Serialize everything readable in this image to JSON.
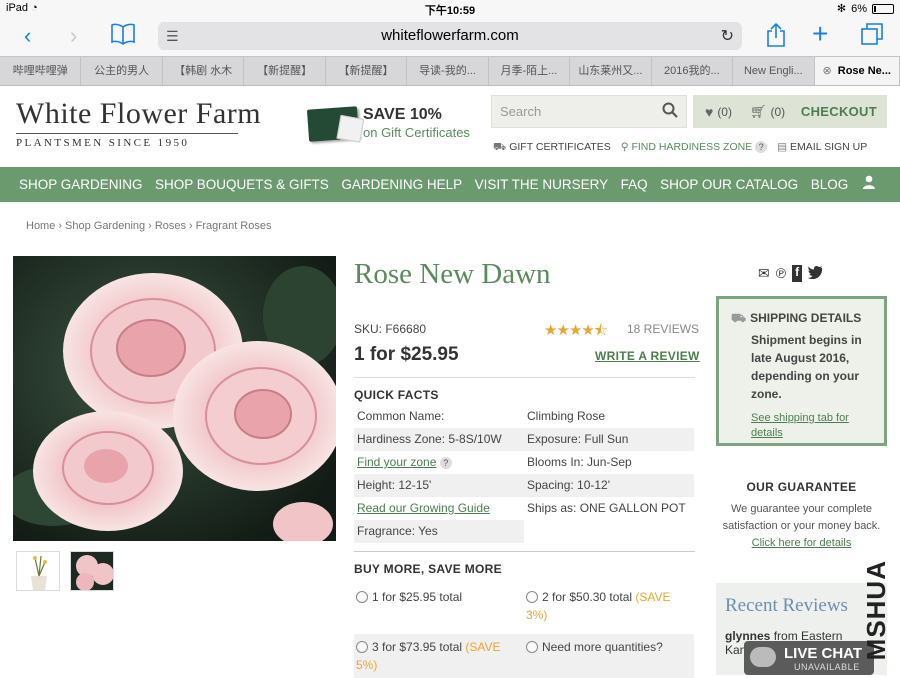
{
  "status": {
    "device": "iPad",
    "time": "下午10:59",
    "battery": "6%"
  },
  "browser": {
    "url": "whiteflowerfarm.com"
  },
  "tabs": [
    "哔哩哔哩弹",
    "公主的男人",
    "【韩剧 水木",
    "【新提醒】",
    "【新提醒】",
    "导读-我的...",
    "月季-陌上...",
    "山东莱州又...",
    "2016我的...",
    "New Engli...",
    "Rose Ne..."
  ],
  "site": {
    "logo_main": "White Flower Farm",
    "logo_sub": "PLANTSMEN SINCE 1950",
    "promo_a": "SAVE 10%",
    "promo_b": "on Gift Certificates",
    "search_placeholder": "Search",
    "wishlist_count": "(0)",
    "cart_count": "(0)",
    "checkout": "CHECKOUT",
    "gift_certificates": "GIFT CERTIFICATES",
    "find_zone": "FIND HARDINESS ZONE",
    "email_signup": "EMAIL SIGN UP"
  },
  "nav": [
    "SHOP GARDENING",
    "SHOP BOUQUETS & GIFTS",
    "GARDENING HELP",
    "VISIT THE NURSERY",
    "FAQ",
    "SHOP OUR CATALOG",
    "BLOG"
  ],
  "breadcrumb": [
    "Home",
    "Shop Gardening",
    "Roses",
    "Fragrant Roses"
  ],
  "product": {
    "title": "Rose New Dawn",
    "sku": "SKU: F66680",
    "rating": 4.5,
    "reviews": "18 REVIEWS",
    "price": "1 for $25.95",
    "write_review": "WRITE A REVIEW",
    "quick_facts_title": "QUICK FACTS",
    "facts": [
      [
        "Common Name:",
        "Climbing Rose"
      ],
      [
        "Hardiness Zone: 5-8S/10W",
        "Exposure: Full Sun"
      ],
      [
        "Find your zone",
        "Blooms In: Jun-Sep"
      ],
      [
        "Height: 12-15'",
        "Spacing: 10-12'"
      ],
      [
        "Read our Growing Guide",
        "Ships as: ONE GALLON POT"
      ],
      [
        "Fragrance: Yes",
        ""
      ]
    ],
    "buy_more_title": "BUY MORE, SAVE MORE",
    "buy": {
      "o1": "1 for $25.95 total",
      "o2": "2 for $50.30 total",
      "o2_save": "(SAVE 3%)",
      "o3": "3 for $73.95 total",
      "o3_save": "(SAVE 5%)",
      "o4": "Need more quantities?"
    }
  },
  "shipping": {
    "title": "SHIPPING DETAILS",
    "body": "Shipment begins in late August 2016, depending on your zone.",
    "link": "See shipping tab for details"
  },
  "guarantee": {
    "title": "OUR GUARANTEE",
    "text": "We guarantee your complete satisfaction or your money back.",
    "link": "Click here for details"
  },
  "recent": {
    "title": "Recent Reviews",
    "who": "glynnes",
    "from": "from Eastern",
    "cut": "Kan"
  },
  "livechat": {
    "title": "LIVE CHAT",
    "status": "UNAVAILABLE"
  },
  "watermark": "MSHUA"
}
